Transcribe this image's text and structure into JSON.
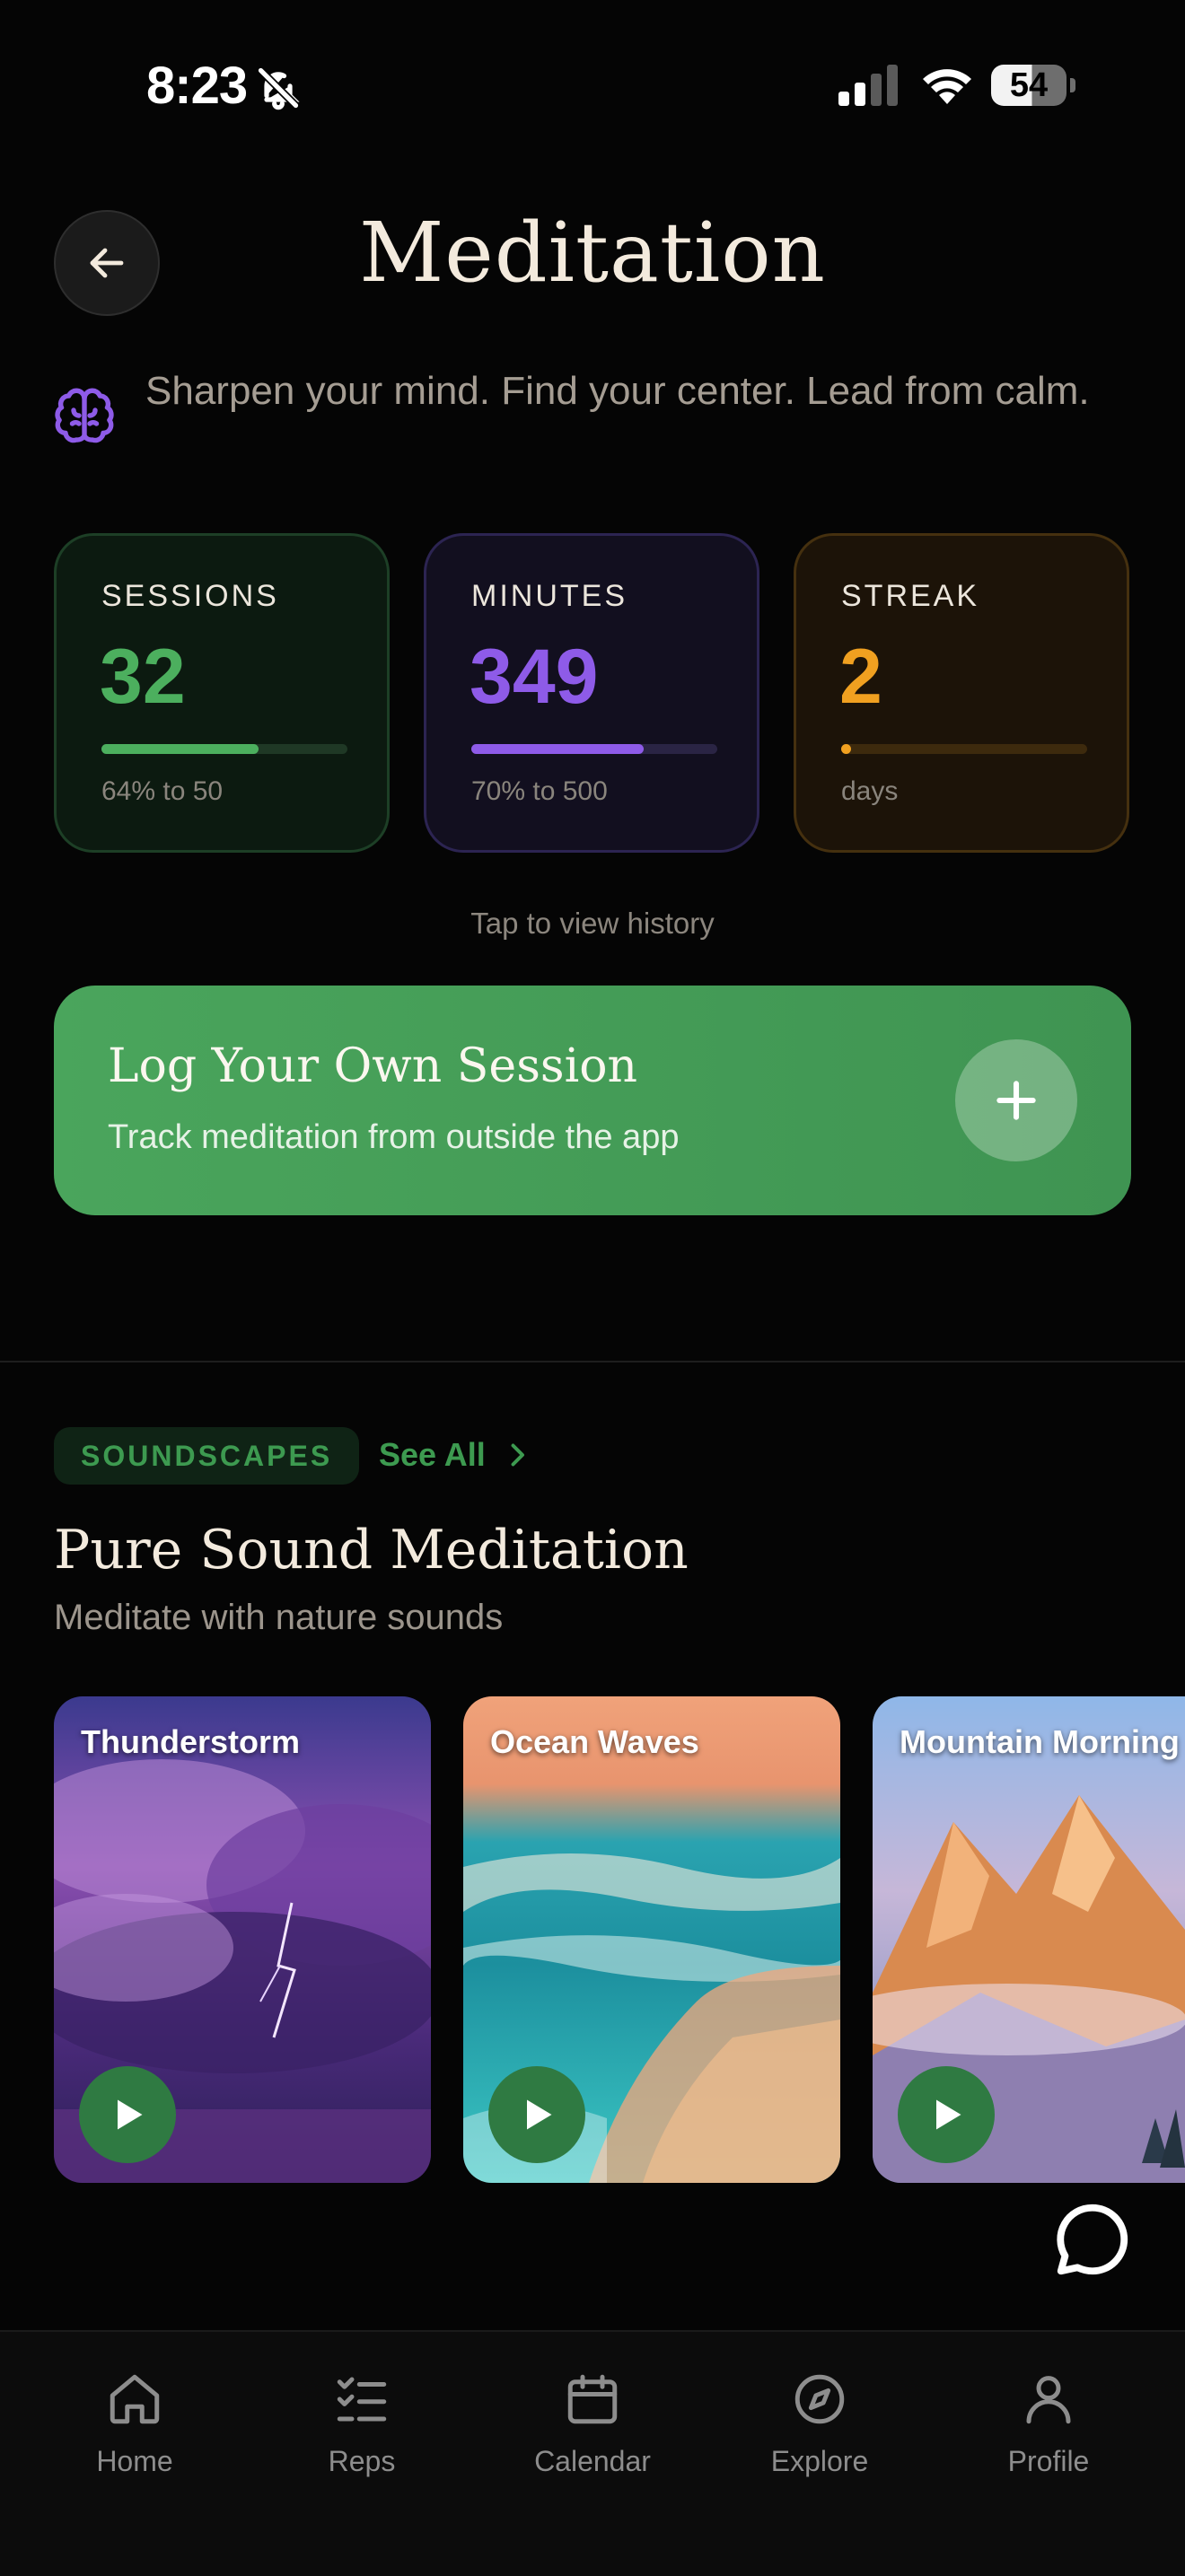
{
  "status_bar": {
    "time": "8:23",
    "battery": "54"
  },
  "header": {
    "title": "Meditation",
    "subtitle": "Sharpen your mind. Find your center. Lead from calm."
  },
  "stats": [
    {
      "label": "SESSIONS",
      "value": "32",
      "note": "64% to 50",
      "progress": 0.64,
      "color": "#4caf5e"
    },
    {
      "label": "MINUTES",
      "value": "349",
      "note": "70% to 500",
      "progress": 0.7,
      "color": "#8e5be8"
    },
    {
      "label": "STREAK",
      "value": "2",
      "note": "days",
      "progress": 0.04,
      "color": "#f0a020"
    }
  ],
  "history_link": "Tap to view history",
  "log_session": {
    "title": "Log Your Own Session",
    "subtitle": "Track meditation from outside the app"
  },
  "soundscapes": {
    "tag": "SOUNDSCAPES",
    "see_all": "See All",
    "title": "Pure Sound Meditation",
    "subtitle": "Meditate with nature sounds",
    "items": [
      {
        "name": "Thunderstorm"
      },
      {
        "name": "Ocean Waves"
      },
      {
        "name": "Mountain Morning"
      }
    ]
  },
  "tabs": [
    {
      "label": "Home",
      "icon": "home-icon"
    },
    {
      "label": "Reps",
      "icon": "checklist-icon"
    },
    {
      "label": "Calendar",
      "icon": "calendar-icon"
    },
    {
      "label": "Explore",
      "icon": "compass-icon"
    },
    {
      "label": "Profile",
      "icon": "person-icon"
    }
  ]
}
